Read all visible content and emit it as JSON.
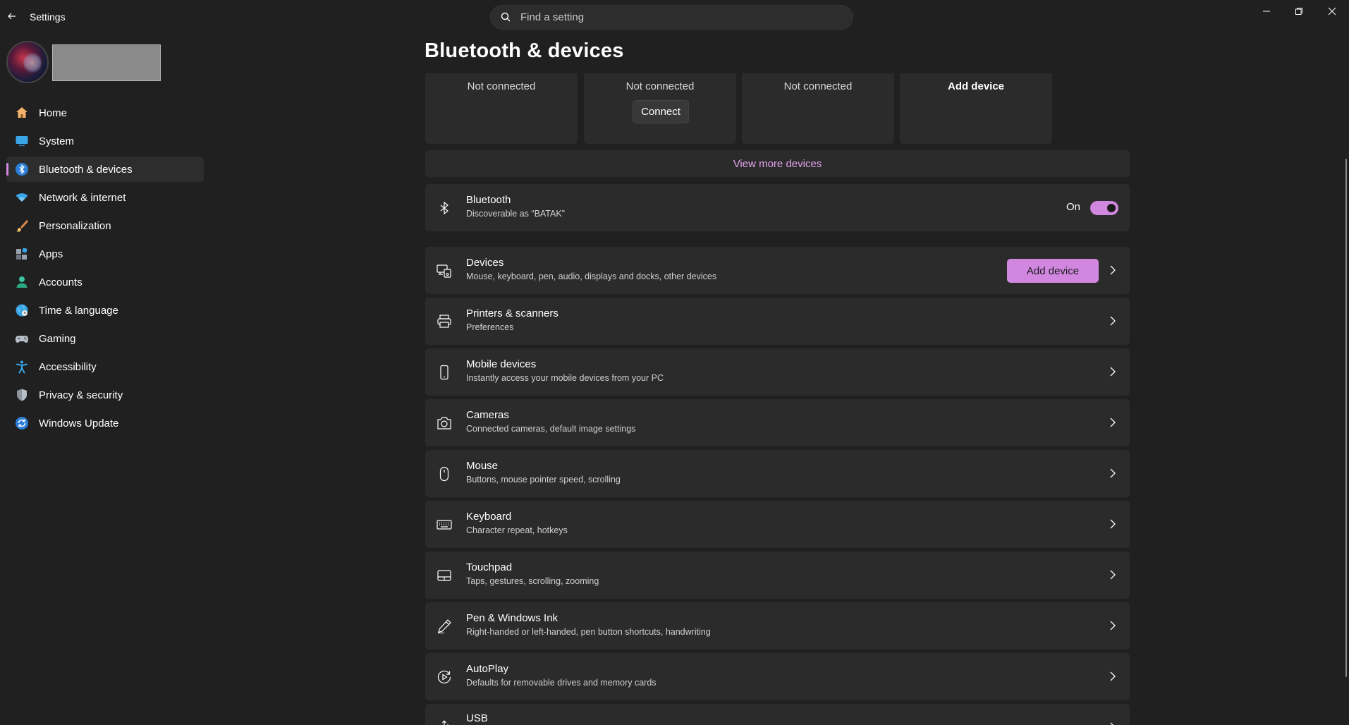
{
  "app": {
    "title": "Settings",
    "search_placeholder": "Find a setting"
  },
  "page": {
    "title": "Bluetooth & devices"
  },
  "sidebar": {
    "items": [
      {
        "label": "Home"
      },
      {
        "label": "System"
      },
      {
        "label": "Bluetooth & devices",
        "active": true
      },
      {
        "label": "Network & internet"
      },
      {
        "label": "Personalization"
      },
      {
        "label": "Apps"
      },
      {
        "label": "Accounts"
      },
      {
        "label": "Time & language"
      },
      {
        "label": "Gaming"
      },
      {
        "label": "Accessibility"
      },
      {
        "label": "Privacy & security"
      },
      {
        "label": "Windows Update"
      }
    ]
  },
  "device_tiles": [
    {
      "status": "Not connected"
    },
    {
      "status": "Not connected",
      "button": "Connect"
    },
    {
      "status": "Not connected"
    },
    {
      "label": "Add device"
    }
  ],
  "view_more": "View more devices",
  "bluetooth": {
    "title": "Bluetooth",
    "subtitle": "Discoverable as “BATAK”",
    "state_label": "On",
    "enabled": true
  },
  "devices_card": {
    "title": "Devices",
    "subtitle": "Mouse, keyboard, pen, audio, displays and docks, other devices",
    "button": "Add device"
  },
  "cards": [
    {
      "title": "Printers & scanners",
      "subtitle": "Preferences",
      "icon": "printer-icon"
    },
    {
      "title": "Mobile devices",
      "subtitle": "Instantly access your mobile devices from your PC",
      "icon": "phone-icon"
    },
    {
      "title": "Cameras",
      "subtitle": "Connected cameras, default image settings",
      "icon": "camera-icon"
    },
    {
      "title": "Mouse",
      "subtitle": "Buttons, mouse pointer speed, scrolling",
      "icon": "mouse-icon"
    },
    {
      "title": "Keyboard",
      "subtitle": "Character repeat, hotkeys",
      "icon": "keyboard-icon"
    },
    {
      "title": "Touchpad",
      "subtitle": "Taps, gestures, scrolling, zooming",
      "icon": "touchpad-icon"
    },
    {
      "title": "Pen & Windows Ink",
      "subtitle": "Right-handed or left-handed, pen button shortcuts, handwriting",
      "icon": "pen-icon"
    },
    {
      "title": "AutoPlay",
      "subtitle": "Defaults for removable drives and memory cards",
      "icon": "autoplay-icon"
    },
    {
      "title": "USB",
      "subtitle": "",
      "icon": "usb-icon"
    }
  ],
  "colors": {
    "accent": "#d187e0",
    "link": "#e4a2ee",
    "background": "#202020",
    "card": "#2b2b2b"
  }
}
